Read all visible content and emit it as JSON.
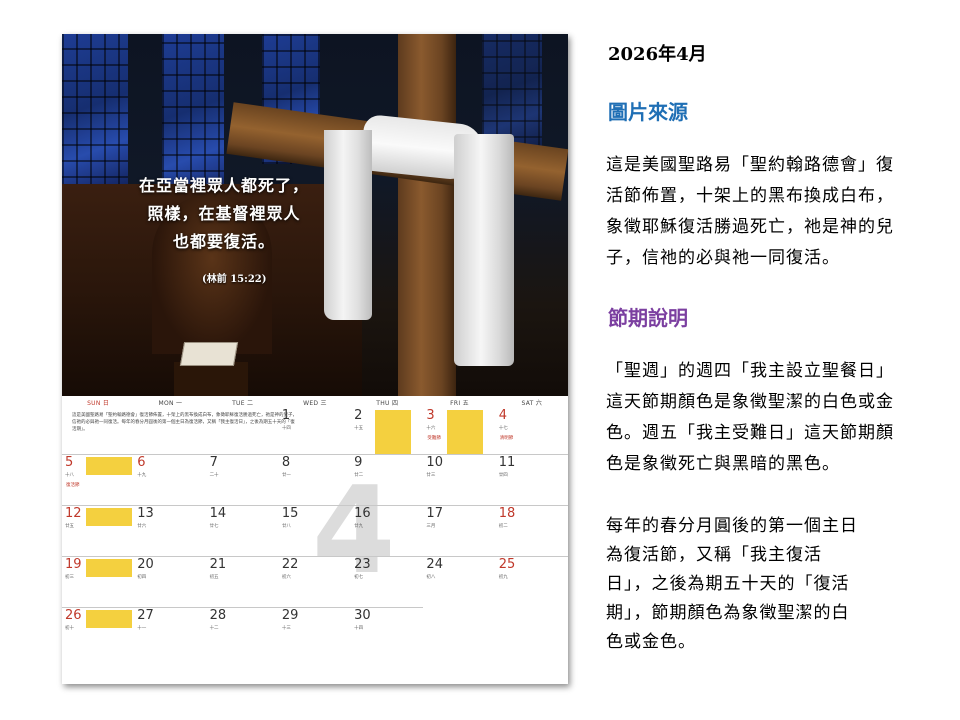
{
  "calendar": {
    "verse_lines": [
      "在亞當裡眾人都死了，",
      "照樣，在基督裡眾人",
      "也都要復活。"
    ],
    "verse_ref": "(林前 15:22)",
    "weekdays": [
      "SUN 日",
      "MON 一",
      "TUE 二",
      "WED 三",
      "THU 四",
      "FRI 五",
      "SAT 六"
    ],
    "big_month": "4",
    "intro": "這是美國聖路易「聖約翰路德會」復活節佈置，十架上的黑布換成白布，象徵耶穌復活勝過死亡，祂是神的兒子，信祂的必與祂一同復活。每年的春分月圓後的第一個主日為復活節，又稱「我主復活日」，之後為期五十天的「復活期」。",
    "days": [
      {
        "d": "1",
        "lunar": "十四",
        "red": false
      },
      {
        "d": "2",
        "lunar": "十五",
        "red": false
      },
      {
        "d": "3",
        "lunar": "十六",
        "red": true,
        "tag": "受難節"
      },
      {
        "d": "4",
        "lunar": "十七",
        "red": true,
        "tag": "清明節"
      },
      {
        "d": "5",
        "lunar": "十八",
        "red": true,
        "tag": "復活節"
      },
      {
        "d": "6",
        "lunar": "十九",
        "red": true
      },
      {
        "d": "7",
        "lunar": "二十",
        "red": false
      },
      {
        "d": "8",
        "lunar": "廿一",
        "red": false
      },
      {
        "d": "9",
        "lunar": "廿二",
        "red": false
      },
      {
        "d": "10",
        "lunar": "廿三",
        "red": false
      },
      {
        "d": "11",
        "lunar": "廿四",
        "red": false
      },
      {
        "d": "12",
        "lunar": "廿五",
        "red": true
      },
      {
        "d": "13",
        "lunar": "廿六",
        "red": false
      },
      {
        "d": "14",
        "lunar": "廿七",
        "red": false
      },
      {
        "d": "15",
        "lunar": "廿八",
        "red": false
      },
      {
        "d": "16",
        "lunar": "廿九",
        "red": false
      },
      {
        "d": "17",
        "lunar": "三月",
        "red": false
      },
      {
        "d": "18",
        "lunar": "初二",
        "red": true
      },
      {
        "d": "19",
        "lunar": "初三",
        "red": true
      },
      {
        "d": "20",
        "lunar": "初四",
        "red": false
      },
      {
        "d": "21",
        "lunar": "初五",
        "red": false
      },
      {
        "d": "22",
        "lunar": "初六",
        "red": false
      },
      {
        "d": "23",
        "lunar": "初七",
        "red": false
      },
      {
        "d": "24",
        "lunar": "初八",
        "red": false
      },
      {
        "d": "25",
        "lunar": "初九",
        "red": true
      },
      {
        "d": "26",
        "lunar": "初十",
        "red": true
      },
      {
        "d": "27",
        "lunar": "十一",
        "red": false
      },
      {
        "d": "28",
        "lunar": "十二",
        "red": false
      },
      {
        "d": "29",
        "lunar": "十三",
        "red": false
      },
      {
        "d": "30",
        "lunar": "十四",
        "red": false
      }
    ]
  },
  "side": {
    "title": "2026年4月",
    "heading1": "圖片來源",
    "para1": "這是美國聖路易「聖約翰路德會」復活節佈置，十架上的黑布換成白布，象徵耶穌復活勝過死亡，祂是神的兒子，信祂的必與祂一同復活。",
    "heading2": "節期說明",
    "para2": "「聖週」的週四「我主設立聖餐日」這天節期顏色是象徵聖潔的白色或金色。週五「我主受難日」這天節期顏色是象徵死亡與黑暗的黑色。",
    "para3": "每年的春分月圓後的第一個主日為復活節，又稱「我主復活日」，之後為期五十天的「復活期」，節期顏色為象徵聖潔的白色或金色。"
  },
  "colors": {
    "heading1": "#1f6fb5",
    "heading2": "#7b3fa0",
    "highlight": "#f4d03f",
    "sunday": "#c0392b"
  }
}
